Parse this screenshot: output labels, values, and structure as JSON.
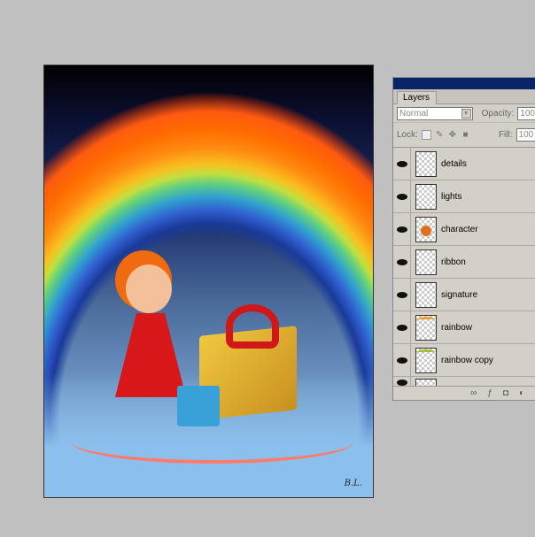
{
  "canvas": {
    "signature": "B.L."
  },
  "panel": {
    "tab": "Layers",
    "blend_mode": "Normal",
    "opacity_label": "Opacity:",
    "opacity_value": "100",
    "lock_label": "Lock:",
    "fill_label": "Fill:",
    "fill_value": "100",
    "layers": [
      {
        "name": "details",
        "visible": true
      },
      {
        "name": "lights",
        "visible": true
      },
      {
        "name": "character",
        "visible": true
      },
      {
        "name": "ribbon",
        "visible": true
      },
      {
        "name": "signature",
        "visible": true
      },
      {
        "name": "rainbow",
        "visible": true
      },
      {
        "name": "rainbow copy",
        "visible": true
      },
      {
        "name": "",
        "visible": true
      }
    ]
  }
}
